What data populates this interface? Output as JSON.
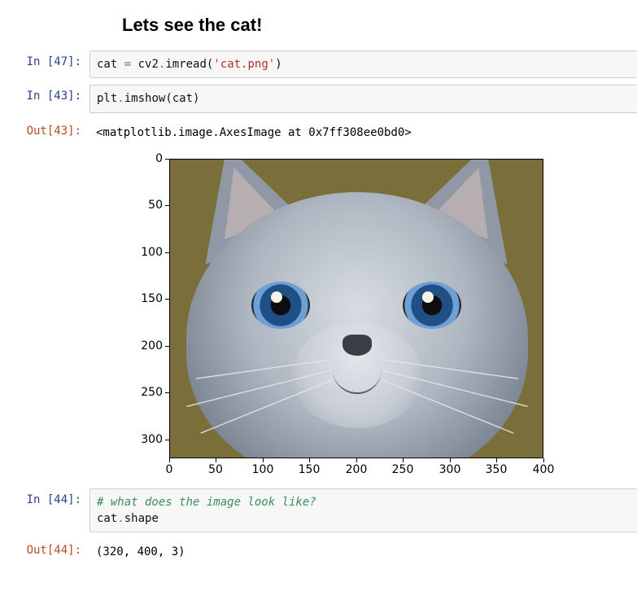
{
  "heading": "Lets see the cat!",
  "cells": {
    "c0": {
      "in_prompt": "In [47]:",
      "code": {
        "var": "cat",
        "eq": " = ",
        "lib": "cv2",
        "dot": ".",
        "func": "imread",
        "open": "(",
        "str": "'cat.png'",
        "close": ")"
      }
    },
    "c1": {
      "in_prompt": "In [43]:",
      "code": {
        "lib": "plt",
        "dot": ".",
        "func": "imshow",
        "open": "(",
        "arg": "cat",
        "close": ")"
      },
      "out_prompt": "Out[43]:",
      "out_text": "<matplotlib.image.AxesImage at 0x7ff308ee0bd0>"
    },
    "c2": {
      "in_prompt": "In [44]:",
      "code": {
        "comment": "# what does the image look like?",
        "line2_a": "cat",
        "line2_b": ".",
        "line2_c": "shape"
      },
      "out_prompt": "Out[44]:",
      "out_text": "(320, 400, 3)"
    }
  },
  "chart_data": {
    "type": "image",
    "title": "",
    "xlabel": "",
    "ylabel": "",
    "xlim": [
      0,
      400
    ],
    "ylim": [
      320,
      0
    ],
    "xticks": [
      0,
      50,
      100,
      150,
      200,
      250,
      300,
      350,
      400
    ],
    "yticks": [
      0,
      50,
      100,
      150,
      200,
      250,
      300
    ],
    "image_shape": [
      320,
      400,
      3
    ],
    "description": "RGB image of a grey British Shorthair cat with blue eyes on an olive-brown background, shown via plt.imshow"
  }
}
